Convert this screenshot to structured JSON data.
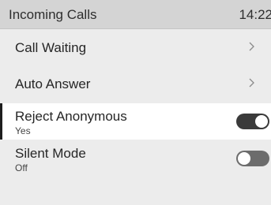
{
  "header": {
    "title": "Incoming Calls",
    "time": "14:22"
  },
  "items": [
    {
      "label": "Call Waiting",
      "type": "submenu",
      "icon": "chevron-right-icon"
    },
    {
      "label": "Auto Answer",
      "type": "submenu",
      "icon": "chevron-right-icon"
    },
    {
      "label": "Reject Anonymous",
      "value": "Yes",
      "type": "toggle",
      "state": "on",
      "selected": true
    },
    {
      "label": "Silent Mode",
      "value": "Off",
      "type": "toggle",
      "state": "off"
    }
  ],
  "colors": {
    "header_bg": "#d4d4d4",
    "list_bg": "#ececec",
    "selected_bg": "#ffffff",
    "toggle_on": "#3a3a3a",
    "toggle_off": "#6c6c6c"
  }
}
